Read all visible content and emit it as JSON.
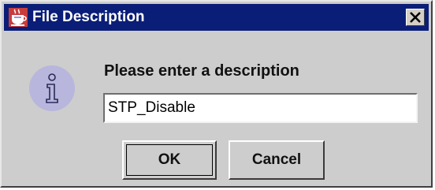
{
  "window": {
    "title": "File Description",
    "app_icon": "java-cup-icon",
    "close_icon": "close-icon"
  },
  "message": {
    "icon": "info-icon",
    "prompt": "Please enter a description"
  },
  "description_field": {
    "value": "STP_Disable",
    "placeholder": ""
  },
  "buttons": {
    "ok_label": "OK",
    "cancel_label": "Cancel"
  },
  "colors": {
    "titlebar": "#0a1e78",
    "dialog_bg": "#cdcdcd",
    "info_icon_bg": "#b8b6dc"
  }
}
